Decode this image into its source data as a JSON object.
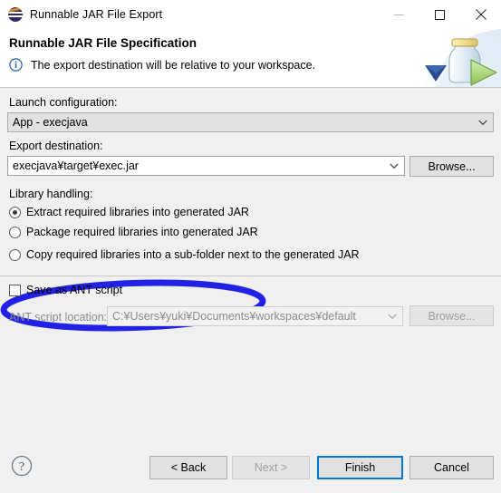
{
  "window": {
    "title": "Runnable JAR File Export",
    "app_icon": "eclipse-icon",
    "controls": {
      "minimize": "minimize-icon",
      "maximize": "maximize-icon",
      "close": "close-icon"
    }
  },
  "header": {
    "title": "Runnable JAR File Specification",
    "description": "The export destination will be relative to your workspace.",
    "info_icon": "info-icon",
    "banner_icon": "jar-export-banner-icon"
  },
  "form": {
    "launch_configuration": {
      "label": "Launch configuration:",
      "value": "App - execjava"
    },
    "export_destination": {
      "label": "Export destination:",
      "value": "execjava¥target¥exec.jar",
      "browse_label": "Browse..."
    },
    "library_handling": {
      "label": "Library handling:",
      "selected_index": 0,
      "options": [
        "Extract required libraries into generated JAR",
        "Package required libraries into generated JAR",
        "Copy required libraries into a sub-folder next to the generated JAR"
      ]
    },
    "ant": {
      "save_as_ant_script_label": "Save as ANT script",
      "save_as_ant_script_checked": false,
      "script_location_label": "ANT script location:",
      "script_location_value": "C:¥Users¥yuki¥Documents¥workspaces¥default",
      "browse_label": "Browse..."
    }
  },
  "footer": {
    "help_icon": "help-icon",
    "buttons": {
      "back": "< Back",
      "next": "Next >",
      "finish": "Finish",
      "cancel": "Cancel"
    }
  },
  "annotation": {
    "shape": "ellipse-highlight",
    "color": "#2222e6",
    "target": "Extract required libraries into generated JAR"
  }
}
